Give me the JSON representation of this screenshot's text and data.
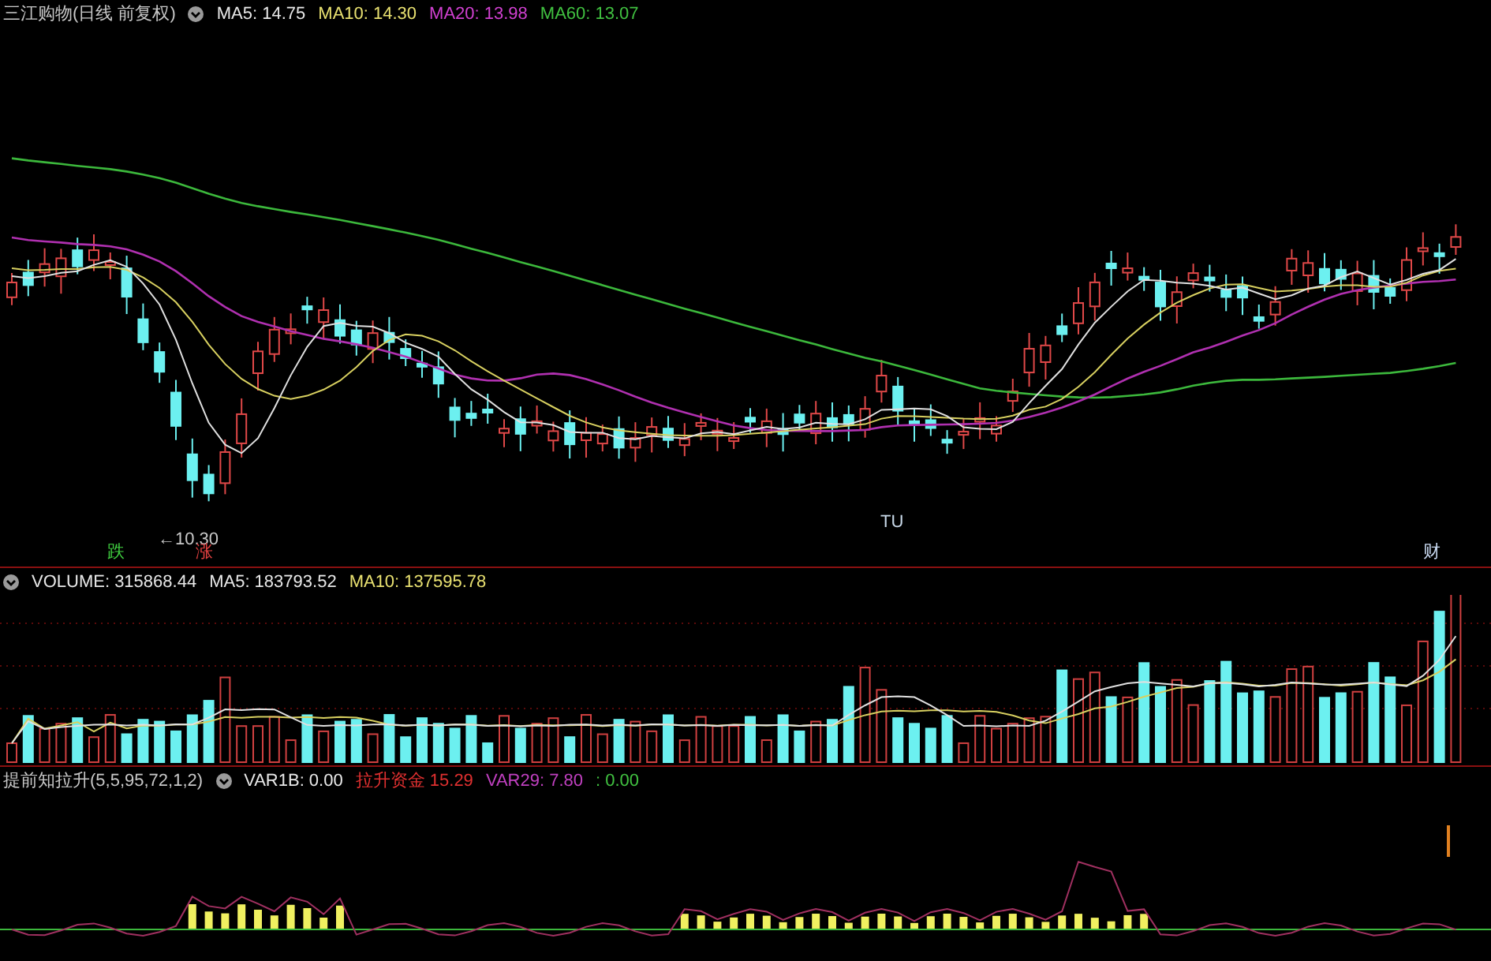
{
  "price_panel": {
    "name": "三江购物(日线 前复权)",
    "indicators": [
      {
        "label": "MA5: 14.75",
        "color": "#e8e8e8"
      },
      {
        "label": "MA10: 14.30",
        "color": "#e8e070"
      },
      {
        "label": "MA20: 13.98",
        "color": "#d040d0"
      },
      {
        "label": "MA60: 13.07",
        "color": "#40c040"
      }
    ],
    "low_label": "←10.30",
    "markers": [
      {
        "text": "跌",
        "color": "#40d040"
      },
      {
        "text": "涨",
        "color": "#e04040"
      },
      {
        "text": "TU",
        "color": "#c8d8e8"
      },
      {
        "text": "财",
        "color": "#c8d8f0"
      }
    ]
  },
  "volume_panel": {
    "indicators": [
      {
        "label": "VOLUME: 315868.44",
        "color": "#e8e8e8"
      },
      {
        "label": "MA5: 183793.52",
        "color": "#e8e8e8"
      },
      {
        "label": "MA10: 137595.78",
        "color": "#e8e070"
      }
    ]
  },
  "signal_panel": {
    "name": "提前知拉升(5,5,95,72,1,2)",
    "indicators": [
      {
        "label": "VAR1B: 0.00",
        "color": "#e8e8e8"
      },
      {
        "label": "拉升资金 15.29",
        "color": "#e03030"
      },
      {
        "label": "VAR29: 7.80",
        "color": "#c040c0"
      },
      {
        "label": ": 0.00",
        "color": "#40c040"
      }
    ]
  }
}
